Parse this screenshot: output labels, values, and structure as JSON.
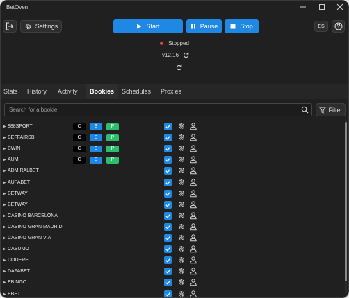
{
  "window": {
    "title": "BetOven",
    "language": "ES"
  },
  "toolbar": {
    "settings_label": "Settings",
    "start_label": "Start",
    "pause_label": "Pause",
    "stop_label": "Stop"
  },
  "status": {
    "text": "Stopped",
    "version": "v12.16",
    "status_color": "#e04040"
  },
  "tabs": [
    {
      "label": "Stats"
    },
    {
      "label": "History"
    },
    {
      "label": "Activity"
    },
    {
      "label": "Bookies"
    },
    {
      "label": "Schedules"
    },
    {
      "label": "Proxies"
    }
  ],
  "active_tab": "Bookies",
  "search": {
    "placeholder": "Search for a bookie",
    "filter_label": "Filter"
  },
  "badge_labels": {
    "c": "C",
    "s": "S",
    "p": "P"
  },
  "colors": {
    "accent": "#1f88e5",
    "badge_p": "#2ebd6e",
    "badge_c": "#000000"
  },
  "bookies": [
    {
      "name": "888SPORT",
      "badges": true,
      "checked": true
    },
    {
      "name": "BEFFAIRSB",
      "badges": true,
      "checked": true
    },
    {
      "name": "BWIN",
      "badges": true,
      "checked": true
    },
    {
      "name": "AUM",
      "badges": true,
      "checked": true
    },
    {
      "name": "ADMIRALBET",
      "badges": false,
      "checked": true
    },
    {
      "name": "AUPABET",
      "badges": false,
      "checked": true
    },
    {
      "name": "BETWAY",
      "badges": false,
      "checked": true
    },
    {
      "name": "BETWAY",
      "badges": false,
      "checked": true
    },
    {
      "name": "CASINO BARCELONA",
      "badges": false,
      "checked": true
    },
    {
      "name": "CASINO GRAN MADRID",
      "badges": false,
      "checked": true
    },
    {
      "name": "CASINO GRAN VIA",
      "badges": false,
      "checked": true
    },
    {
      "name": "CASUMO",
      "badges": false,
      "checked": true
    },
    {
      "name": "CODERE",
      "badges": false,
      "checked": true
    },
    {
      "name": "DAFABET",
      "badges": false,
      "checked": true
    },
    {
      "name": "EBINGO",
      "badges": false,
      "checked": true
    },
    {
      "name": "EBET",
      "badges": false,
      "checked": true
    }
  ]
}
